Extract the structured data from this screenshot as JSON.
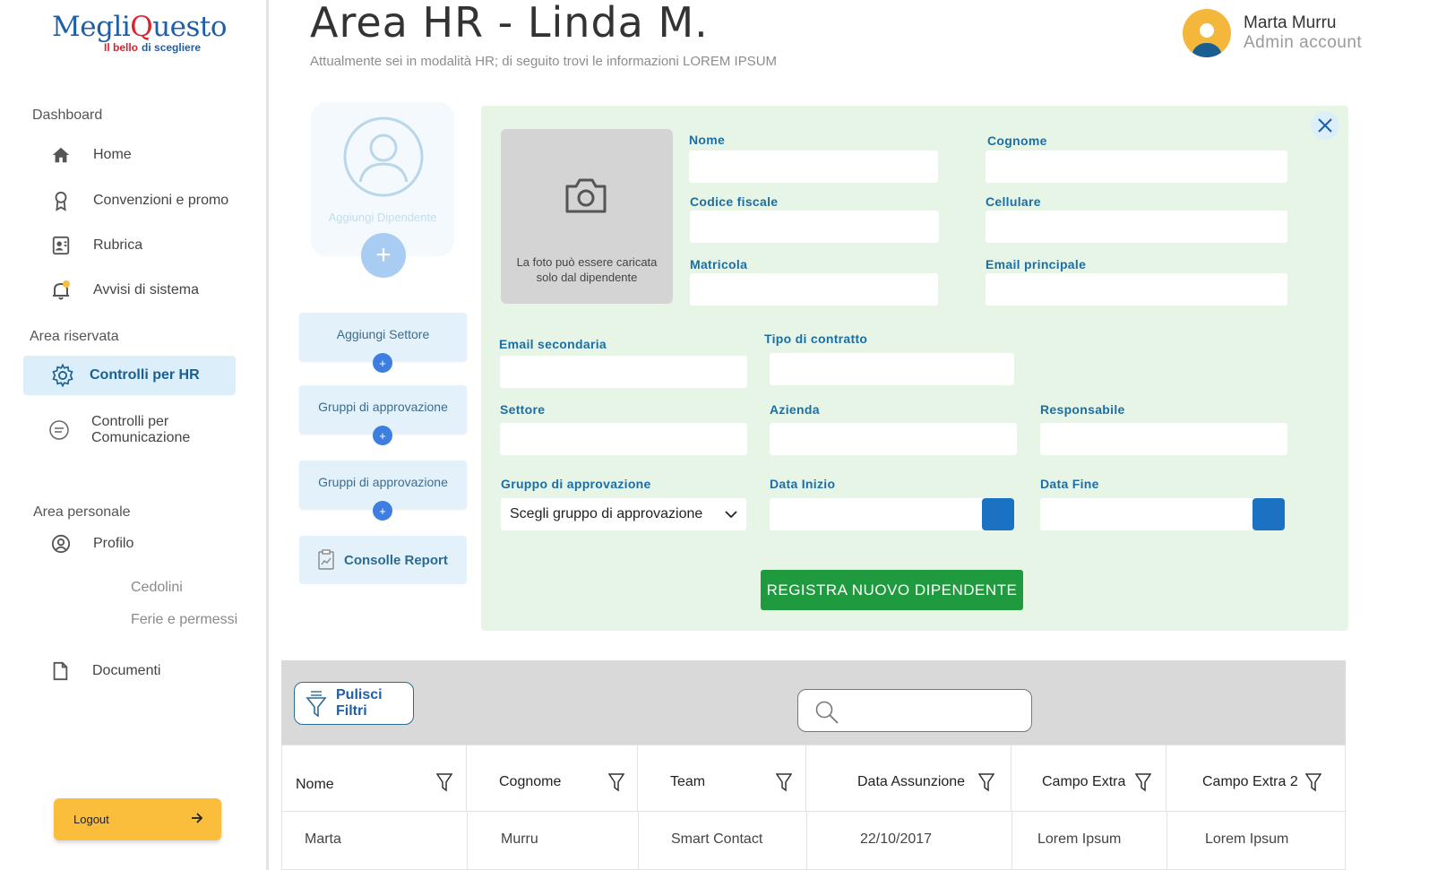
{
  "logo": {
    "part1": "Megli",
    "part2": "uesto",
    "q": "Q",
    "tag1": "Il bello",
    "tag2": "di scegliere"
  },
  "sidebar": {
    "section_dashboard": "Dashboard",
    "items": [
      {
        "label": "Home",
        "icon": "home-icon"
      },
      {
        "label": "Convenzioni e promo",
        "icon": "award-icon"
      },
      {
        "label": "Rubrica",
        "icon": "contact-card-icon"
      },
      {
        "label": "Avvisi di sistema",
        "icon": "bell-icon"
      }
    ],
    "section_reserved": "Area riservata",
    "active_item": "Controlli per HR",
    "comm_item": "Controlli per Comunicazione",
    "section_personal": "Area personale",
    "profile_item": "Profilo",
    "sub_items": [
      "Cedolini",
      "Ferie e permessi"
    ],
    "documents_item": "Documenti",
    "logout": "Logout"
  },
  "header": {
    "title": "Area HR - Linda M.",
    "subtitle": "Attualmente sei in modalità HR; di seguito trovi le informazioni LOREM IPSUM",
    "user_name": "Marta Murru",
    "user_role": "Admin account"
  },
  "actions": {
    "add_employee": "Aggiungi Dipendente",
    "add_sector": "Aggiungi Settore",
    "approval_groups_1": "Gruppi di approvazione",
    "approval_groups_2": "Gruppi di approvazione",
    "report_console": "Consolle Report"
  },
  "form": {
    "photo_note": "La foto può essere caricata solo dal dipendente",
    "labels": {
      "nome": "Nome",
      "cognome": "Cognome",
      "codice_fiscale": "Codice fiscale",
      "cellulare": "Cellulare",
      "matricola": "Matricola",
      "email_principale": "Email principale",
      "email_secondaria": "Email secondaria",
      "tipo_contratto": "Tipo di contratto",
      "settore": "Settore",
      "azienda": "Azienda",
      "responsabile": "Responsabile",
      "gruppo_approvazione": "Gruppo di approvazione",
      "data_inizio": "Data Inizio",
      "data_fine": "Data Fine"
    },
    "group_select_value": "Scegli gruppo di approvazione",
    "submit": "REGISTRA  NUOVO DIPENDENTE"
  },
  "table": {
    "clear_filters": "Pulisci Filtri",
    "columns": [
      "Nome",
      "Cognome",
      "Team",
      "Data Assunzione",
      "Campo Extra",
      "Campo Extra 2"
    ],
    "rows": [
      [
        "Marta",
        "Murru",
        "Smart Contact",
        "22/10/2017",
        "Lorem Ipsum",
        "Lorem Ipsum"
      ]
    ]
  },
  "colors": {
    "accent_blue": "#1b72c2",
    "submit_green": "#1f9a3e",
    "logout_yellow": "#fbbd3c",
    "form_bg": "#e7f5e6"
  }
}
